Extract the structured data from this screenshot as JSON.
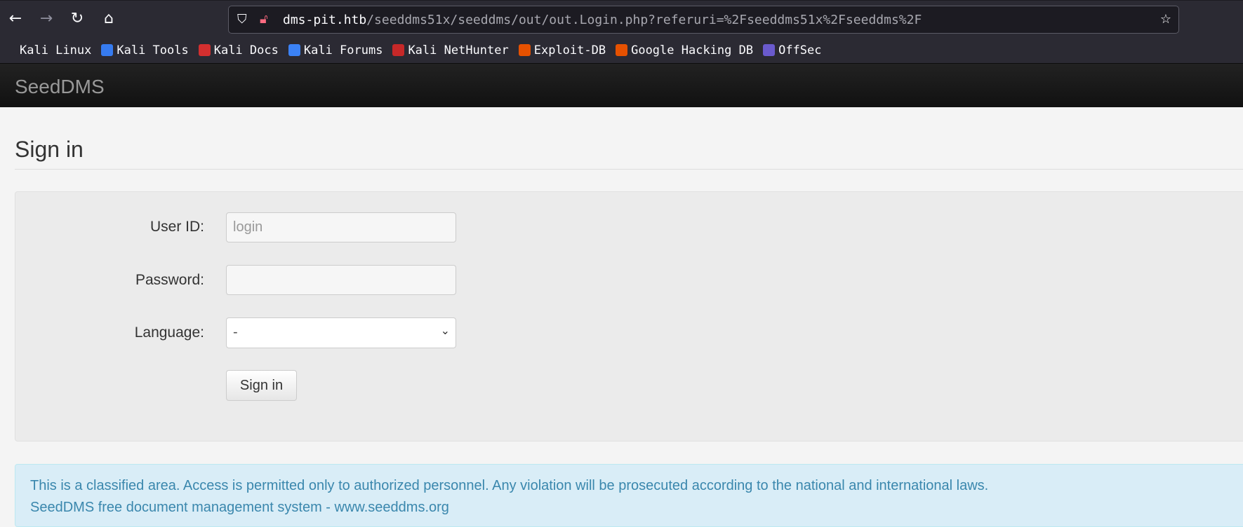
{
  "browser": {
    "url_host": "dms-pit.htb",
    "url_path": "/seeddms51x/seeddms/out/out.Login.php?referuri=%2Fseeddms51x%2Fseeddms%2F",
    "bookmarks": [
      {
        "label": "Kali Linux",
        "color": "#2b2a33"
      },
      {
        "label": "Kali Tools",
        "color": "#367bf0"
      },
      {
        "label": "Kali Docs",
        "color": "#d32f2f"
      },
      {
        "label": "Kali Forums",
        "color": "#3b82f6"
      },
      {
        "label": "Kali NetHunter",
        "color": "#c62828"
      },
      {
        "label": "Exploit-DB",
        "color": "#e65100"
      },
      {
        "label": "Google Hacking DB",
        "color": "#e65100"
      },
      {
        "label": "OffSec",
        "color": "#6a5acd"
      }
    ]
  },
  "app": {
    "brand": "SeedDMS"
  },
  "login": {
    "title": "Sign in",
    "user_label": "User ID:",
    "user_placeholder": "login",
    "password_label": "Password:",
    "language_label": "Language:",
    "language_value": "-",
    "submit": "Sign in"
  },
  "footer": {
    "notice": "This is a classified area. Access is permitted only to authorized personnel. Any violation will be prosecuted according to the national and international laws.",
    "credit": "SeedDMS free document management system - www.seeddms.org"
  }
}
